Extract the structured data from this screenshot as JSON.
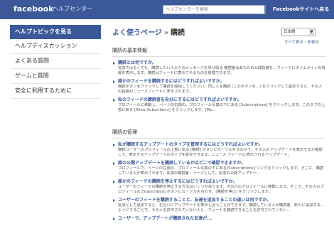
{
  "header": {
    "logo": "facebook",
    "subtitle": "ヘルプセンター",
    "search_placeholder": "ヘルプセンターを検索",
    "go_home": "Facebookサイトへ戻る"
  },
  "sidebar": {
    "items": [
      {
        "label": "ヘルプトピックを見る",
        "active": true
      },
      {
        "label": "ヘルプディスカッション"
      },
      {
        "label": "よくある質問"
      },
      {
        "label": "ゲームと質問"
      },
      {
        "label": "安全に利用するために"
      }
    ]
  },
  "main": {
    "breadcrumb_link": "よく使うページ",
    "breadcrumb_sep": "»",
    "breadcrumb_current": "購読",
    "language": "日本語",
    "toggle_all": "すべて表示・非表示",
    "sections": [
      {
        "title": "購読の基本情報",
        "items": [
          {
            "q": "購読とは何ですか。",
            "a": "友達ではなくても、購読したい人からのメッセージを受け取る 購読者はあなたの公開投稿を…フィードにタイムラインの情報を表示します。購読はフィードに表示されるものを管理できます。"
          },
          {
            "q": "誰かのフィードを購読するにはどうすればよいですか。",
            "a": "購読ボタンをクリックして購読を開始してください。同じ人を購読 (このボタンを…) をクリックして設定すると、その人の投稿がニュースフィードに表示されます。"
          },
          {
            "q": "私のフィードの購読者を自分にするにはどうすればよいですか。",
            "a": "プロフィールに移動し、ページの右側の、プロフィール写真の下にある [Subscriptions] をクリックします。このタブの上部にある [Allow Subscribers] をクリックします。[Me..."
          }
        ]
      },
      {
        "title": "購読の管理",
        "items": [
          {
            "q": "私が購読するアップデートのタイプを管理するにはどうすればよいですか。",
            "a": "購読ユーザーのプロフィールの上部にある [購読] ボタンにカーソルを合わせて、その人のアップデートを表示するか確認して、表示するアップデートのタイプを設定できます。ニュース フィードに表示されるアップデート。"
          },
          {
            "q": "誰の公開アップデートを購読しているかはどこで確認できますか。",
            "a": "プロフィールで、ページの左側の、プロフィール写真の下にある[Subscriptions] リンクをクリックします。そこに、購読している人が表示されます。友達の購読者・ページとして、友達の公開アップデー..."
          },
          {
            "q": "誰かのフィードの購読を停止するにはどうすればよいですか。",
            "a": "ユーザーのフィードの購読を停止する方法はいくつかあります。その人のプロフィールに移動します。そこで、その人のプロフィールの [Subscribed] ボタンにカーソルを合わせ、[購読を停止] をクリックします。"
          },
          {
            "q": "ユーザーのフィードを購読することと、友達を追加することの違いは何ですか。",
            "a": "友達として追加すると、お互いにアップデートを表示し合うことができます。購読している人が購読者、新たに追加する…ようにすることで、その人を許可されていない人と…フィードを購読できることを許可されていない…"
          },
          {
            "q": "ユーザーで、アップデートが購読された友達が...",
            "a": ""
          }
        ]
      }
    ]
  }
}
